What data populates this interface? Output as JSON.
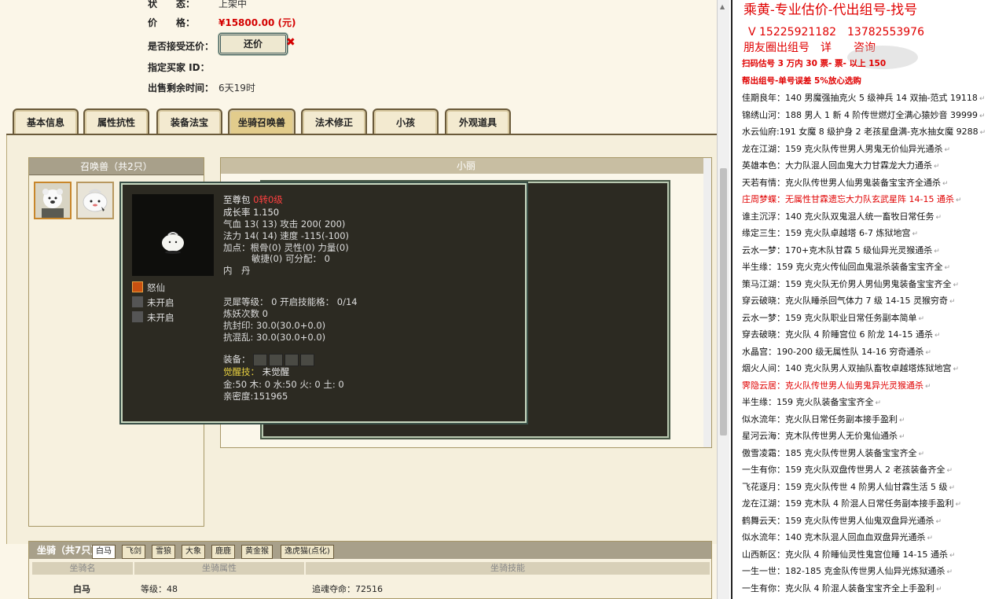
{
  "listing": {
    "status_label": "状　　态：",
    "status_value": "上架中",
    "price_label": "价　　格：",
    "price_value": "¥15800.00 (元)",
    "counter_label": "是否接受还价：",
    "counter_button": "还价",
    "counter_x": "✖",
    "buyer_label": "指定买家 ID：",
    "buyer_value": "",
    "time_label": "出售剩余时间：",
    "time_value": "6天19时"
  },
  "tabs": [
    "基本信息",
    "属性抗性",
    "装备法宝",
    "坐骑召唤兽",
    "法术修正",
    "小孩",
    "外观道具"
  ],
  "summons": {
    "header": "召唤兽（共2只）",
    "detail_header": "小丽"
  },
  "tooltip": {
    "name": "至尊包",
    "rebirth": "0转0级",
    "growth_label": "成长率",
    "growth": "1.150",
    "hp_line_a": "气血 13( 13) 攻击 200( 200)",
    "mp_line_a": "法力 14( 14) 速度 -115(-100)",
    "points_a": "加点：根骨(0) 灵性(0) 力量(0)",
    "points_b": "敏捷(0) 可分配： 0",
    "inner_label": "内　丹",
    "skills": [
      {
        "icon": "fire-skill-icon",
        "label": "怒仙"
      },
      {
        "icon": "locked-skill-icon",
        "label": "未开启"
      },
      {
        "icon": "locked-skill-icon",
        "label": "未开启"
      }
    ],
    "spirit": "灵犀等级： 0 开启技能格： 0/14",
    "refine": "炼妖次数 0",
    "resist_seal": "抗封印: 30.0(30.0+0.0)",
    "resist_chaos": "抗混乱: 30.0(30.0+0.0)",
    "equip_label": "装备：",
    "awaken_label": "觉醒技：",
    "awaken_value": "未觉醒",
    "elements": "金:50 木: 0 水:50 火: 0 土: 0",
    "intimacy": "亲密度:151965"
  },
  "mounts": {
    "header": "坐骑（共7只）",
    "tabs": [
      "白马",
      "飞剑",
      "雪狼",
      "大象",
      "鹿鹿",
      "黄金猴",
      "逸虎猫(点化)"
    ],
    "col_name": "坐骑名",
    "col_attr": "坐骑属性",
    "col_skill": "坐骑技能",
    "row_name": "白马",
    "row_level": "等级：48",
    "row_skill": "追魂夺命：72516"
  },
  "notes": {
    "title": "乘黄-专业估价-代出组号-找号",
    "phones": "V 15225921182　13782553976",
    "circle": "朋友圈出组号　详　　咨询",
    "promo1": "扫码估号 3 万内 30 票-      票-      以上 150",
    "promo2": "帮出组号-单号误差 5%放心选购",
    "lines": [
      {
        "t": "佳期良年：140 男魔强抽克火 5 级神兵 14 双抽-范式 19118",
        "red": false
      },
      {
        "t": "锦绣山河：188 男人 1 新 4 阶传世燃灯全满心猿妙音 39999",
        "red": false
      },
      {
        "t": "水云仙府:191 女魔 8 级护身 2 老孩星盘满-克水抽女魔 9288",
        "red": false
      },
      {
        "t": "龙在江湖：159 克火队传世男人男鬼无价仙异光通杀",
        "red": false
      },
      {
        "t": "英雄本色：大力队混人回血鬼大力甘霖龙大力通杀",
        "red": false
      },
      {
        "t": "天若有情：克火队传世男人仙男鬼装备宝宝齐全通杀",
        "red": false
      },
      {
        "t": "庄周梦蝶：无属性甘霖遗忘大力队玄武星阵 14-15 通杀",
        "red": true
      },
      {
        "t": "谁主沉浮：140 克火队双鬼混人统一畜牧日常任务",
        "red": false
      },
      {
        "t": "缘定三生：159 克火队卓越塔 6-7 炼狱地宫",
        "red": false
      },
      {
        "t": "云水一梦：170+克木队甘霖 5 级仙异光灵猴通杀",
        "red": false
      },
      {
        "t": "半生缘：159 克火克火传仙回血鬼混杀装备宝宝齐全",
        "red": false
      },
      {
        "t": "策马江湖：159 克火队无价男人男仙男鬼装备宝宝齐全",
        "red": false
      },
      {
        "t": "穿云破晓：克火队睡杀回气体力 7 级 14-15 灵猴穷奇",
        "red": false
      },
      {
        "t": "云水一梦：159 克火队职业日常任务副本简单",
        "red": false
      },
      {
        "t": "穿去破晓：克火队 4 阶睡宫位 6 阶龙 14-15 通杀",
        "red": false
      },
      {
        "t": "水晶宫：190-200 级无属性队 14-16 穷奇通杀",
        "red": false
      },
      {
        "t": "烟火人间：140 克火队男人双抽队畜牧卓越塔炼狱地宫",
        "red": false
      },
      {
        "t": "霁隐云居：克火队传世男人仙男鬼异光灵猴通杀",
        "red": true
      },
      {
        "t": "半生缘：159 克火队装备宝宝齐全",
        "red": false
      },
      {
        "t": "似水流年：克火队日常任务副本接手盈利",
        "red": false
      },
      {
        "t": "星河云海：克木队传世男人无价鬼仙通杀",
        "red": false
      },
      {
        "t": "傲雪凌霜：185 克火队传世男人装备宝宝齐全",
        "red": false
      },
      {
        "t": "一生有你：159 克火队双盘传世男人 2 老孩装备齐全",
        "red": false
      },
      {
        "t": "飞花逐月：159 克火队传世 4 阶男人仙甘霖生活 5 级",
        "red": false
      },
      {
        "t": "龙在江湖：159 克木队 4 阶混人日常任务副本接手盈利",
        "red": false
      },
      {
        "t": "鹤舞云天：159 克火队传世男人仙鬼双盘异光通杀",
        "red": false
      },
      {
        "t": "似水流年：140 克木队混人回血血双盘异光通杀",
        "red": false
      },
      {
        "t": "山西新区：克火队 4 阶睡仙灵性鬼宫位睡 14-15 通杀",
        "red": false
      },
      {
        "t": "一生一世：182-185 克金队传世男人仙异光炼狱通杀",
        "red": false
      },
      {
        "t": "一生有你：克火队 4 阶混人装备宝宝齐全上手盈利",
        "red": false
      }
    ],
    "return_glyph": "↵"
  }
}
